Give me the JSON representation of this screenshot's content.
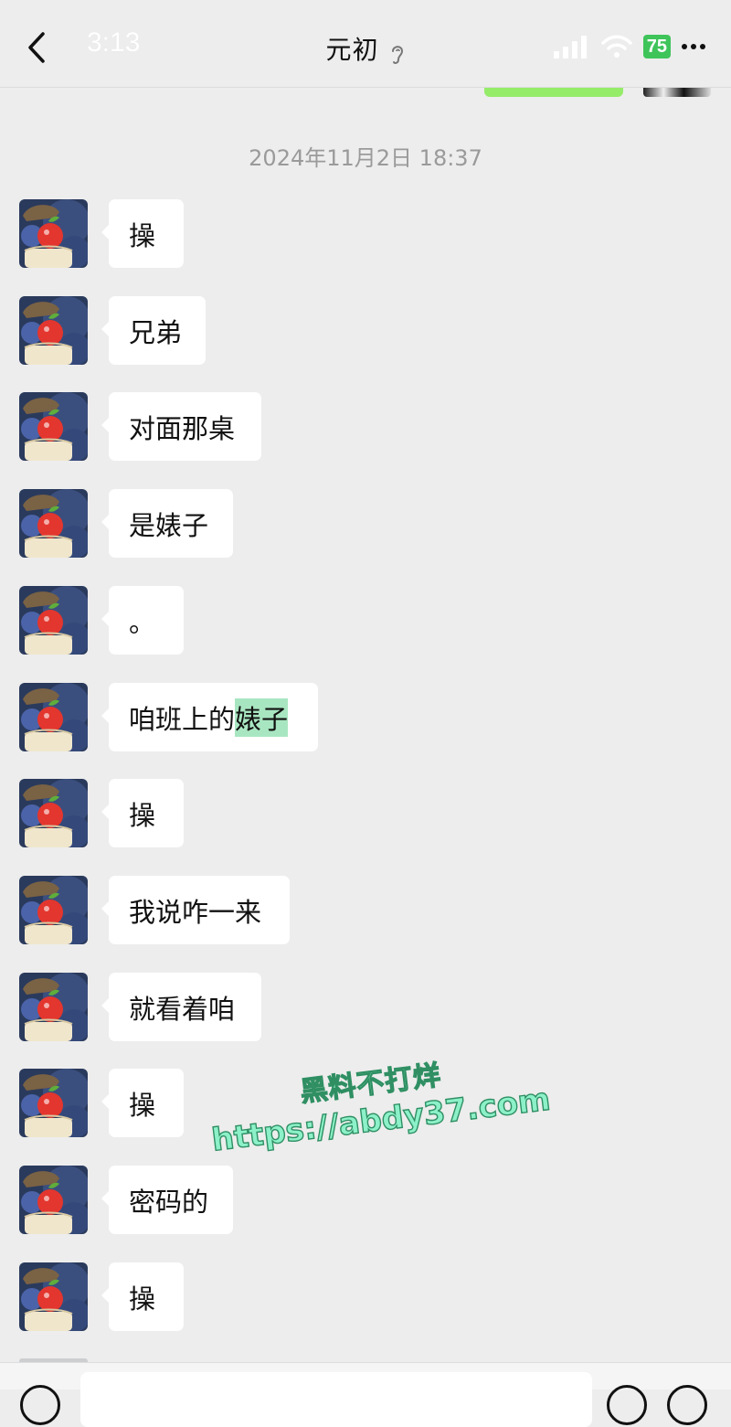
{
  "header": {
    "time": "3:13",
    "title": "元初",
    "battery": "75"
  },
  "timestamp": "2024年11月2日 18:37",
  "messages": [
    {
      "text": "操"
    },
    {
      "text": "兄弟"
    },
    {
      "text": "对面那桌"
    },
    {
      "text": "是婊子"
    },
    {
      "text": "。"
    },
    {
      "text": "咱班上的",
      "highlight": "婊子"
    },
    {
      "text": "操"
    },
    {
      "text": "我说咋一来"
    },
    {
      "text": "就看着咱"
    },
    {
      "text": "操"
    },
    {
      "text": "密码的"
    },
    {
      "text": "操"
    }
  ],
  "watermark": {
    "line1": "黑料不打烊",
    "line2": "https://abdy37.com"
  },
  "icons": {
    "back": "chevron-left-icon",
    "ear": "ear-icon",
    "signal": "signal-icon",
    "wifi": "wifi-icon",
    "more": "more-icon"
  },
  "colors": {
    "background": "#ededed",
    "own_bubble": "#95ec69",
    "incoming_bubble": "#ffffff",
    "battery": "#3fc45a",
    "highlight": "#a8e6c1"
  }
}
